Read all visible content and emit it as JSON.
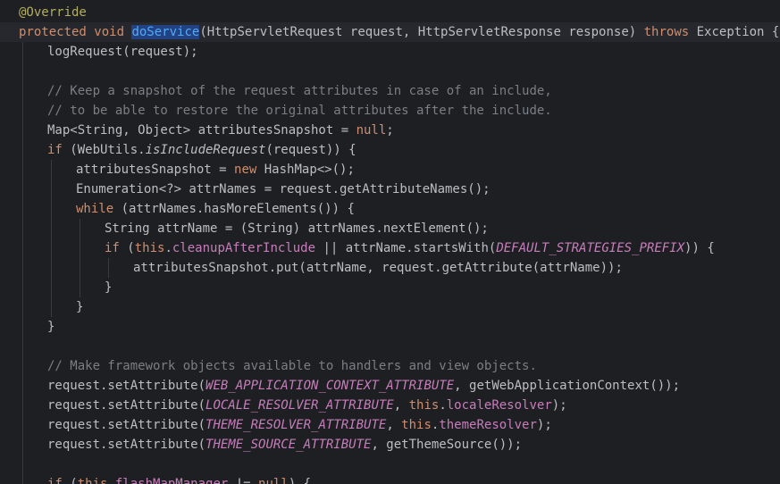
{
  "editor": {
    "colors": {
      "background": "#1e1f22",
      "current_line": "#26282e",
      "keyword": "#cf8e6d",
      "annotation": "#b3ae60",
      "method": "#56a8f5",
      "comment": "#7a7e85",
      "constant": "#c77dbb",
      "text": "#bcbec4",
      "selection": "#214283"
    },
    "lines": [
      {
        "indent": 0,
        "tokens": [
          {
            "t": "ann",
            "v": "@Override"
          }
        ]
      },
      {
        "indent": 0,
        "current": true,
        "tokens": [
          {
            "t": "kw",
            "v": "protected"
          },
          {
            "t": "plain",
            "v": " "
          },
          {
            "t": "kw",
            "v": "void"
          },
          {
            "t": "plain",
            "v": " "
          },
          {
            "t": "fnsel",
            "v": "doService"
          },
          {
            "t": "plain",
            "v": "(HttpServletRequest request, HttpServletResponse response) "
          },
          {
            "t": "kw",
            "v": "throws"
          },
          {
            "t": "plain",
            "v": " Exception {"
          }
        ]
      },
      {
        "indent": 1,
        "tokens": [
          {
            "t": "plain",
            "v": "logRequest(request);"
          }
        ]
      },
      {
        "indent": 1,
        "tokens": []
      },
      {
        "indent": 1,
        "tokens": [
          {
            "t": "cm",
            "v": "// Keep a snapshot of the request attributes in case of an include,"
          }
        ]
      },
      {
        "indent": 1,
        "tokens": [
          {
            "t": "cm",
            "v": "// to be able to restore the original attributes after the include."
          }
        ]
      },
      {
        "indent": 1,
        "tokens": [
          {
            "t": "plain",
            "v": "Map<String, Object> attributesSnapshot = "
          },
          {
            "t": "kw",
            "v": "null"
          },
          {
            "t": "plain",
            "v": ";"
          }
        ]
      },
      {
        "indent": 1,
        "tokens": [
          {
            "t": "kw",
            "v": "if"
          },
          {
            "t": "plain",
            "v": " (WebUtils."
          },
          {
            "t": "static",
            "v": "isIncludeRequest"
          },
          {
            "t": "plain",
            "v": "(request)) {"
          }
        ]
      },
      {
        "indent": 2,
        "tokens": [
          {
            "t": "plain",
            "v": "attributesSnapshot = "
          },
          {
            "t": "kw",
            "v": "new"
          },
          {
            "t": "plain",
            "v": " HashMap<>();"
          }
        ]
      },
      {
        "indent": 2,
        "tokens": [
          {
            "t": "plain",
            "v": "Enumeration<?> attrNames = request.getAttributeNames();"
          }
        ]
      },
      {
        "indent": 2,
        "tokens": [
          {
            "t": "kw",
            "v": "while"
          },
          {
            "t": "plain",
            "v": " (attrNames.hasMoreElements()) {"
          }
        ]
      },
      {
        "indent": 3,
        "tokens": [
          {
            "t": "plain",
            "v": "String attrName = (String) attrNames.nextElement();"
          }
        ]
      },
      {
        "indent": 3,
        "tokens": [
          {
            "t": "kw",
            "v": "if"
          },
          {
            "t": "plain",
            "v": " ("
          },
          {
            "t": "kw",
            "v": "this"
          },
          {
            "t": "plain",
            "v": "."
          },
          {
            "t": "field",
            "v": "cleanupAfterInclude"
          },
          {
            "t": "plain",
            "v": " || attrName.startsWith("
          },
          {
            "t": "const",
            "v": "DEFAULT_STRATEGIES_PREFIX"
          },
          {
            "t": "plain",
            "v": ")) {"
          }
        ]
      },
      {
        "indent": 4,
        "tokens": [
          {
            "t": "plain",
            "v": "attributesSnapshot.put(attrName, request.getAttribute(attrName));"
          }
        ]
      },
      {
        "indent": 3,
        "tokens": [
          {
            "t": "plain",
            "v": "}"
          }
        ]
      },
      {
        "indent": 2,
        "tokens": [
          {
            "t": "plain",
            "v": "}"
          }
        ]
      },
      {
        "indent": 1,
        "tokens": [
          {
            "t": "plain",
            "v": "}"
          }
        ]
      },
      {
        "indent": 1,
        "tokens": []
      },
      {
        "indent": 1,
        "tokens": [
          {
            "t": "cm",
            "v": "// Make framework objects available to handlers and view objects."
          }
        ]
      },
      {
        "indent": 1,
        "tokens": [
          {
            "t": "plain",
            "v": "request.setAttribute("
          },
          {
            "t": "const",
            "v": "WEB_APPLICATION_CONTEXT_ATTRIBUTE"
          },
          {
            "t": "plain",
            "v": ", getWebApplicationContext());"
          }
        ]
      },
      {
        "indent": 1,
        "tokens": [
          {
            "t": "plain",
            "v": "request.setAttribute("
          },
          {
            "t": "const",
            "v": "LOCALE_RESOLVER_ATTRIBUTE"
          },
          {
            "t": "plain",
            "v": ", "
          },
          {
            "t": "kw",
            "v": "this"
          },
          {
            "t": "plain",
            "v": "."
          },
          {
            "t": "field",
            "v": "localeResolver"
          },
          {
            "t": "plain",
            "v": ");"
          }
        ]
      },
      {
        "indent": 1,
        "tokens": [
          {
            "t": "plain",
            "v": "request.setAttribute("
          },
          {
            "t": "const",
            "v": "THEME_RESOLVER_ATTRIBUTE"
          },
          {
            "t": "plain",
            "v": ", "
          },
          {
            "t": "kw",
            "v": "this"
          },
          {
            "t": "plain",
            "v": "."
          },
          {
            "t": "field",
            "v": "themeResolver"
          },
          {
            "t": "plain",
            "v": ");"
          }
        ]
      },
      {
        "indent": 1,
        "tokens": [
          {
            "t": "plain",
            "v": "request.setAttribute("
          },
          {
            "t": "const",
            "v": "THEME_SOURCE_ATTRIBUTE"
          },
          {
            "t": "plain",
            "v": ", getThemeSource());"
          }
        ]
      },
      {
        "indent": 1,
        "tokens": []
      },
      {
        "indent": 1,
        "tokens": [
          {
            "t": "kw",
            "v": "if"
          },
          {
            "t": "plain",
            "v": " ("
          },
          {
            "t": "kw",
            "v": "this"
          },
          {
            "t": "plain",
            "v": "."
          },
          {
            "t": "field",
            "v": "flashMapManager"
          },
          {
            "t": "plain",
            "v": " != "
          },
          {
            "t": "kw",
            "v": "null"
          },
          {
            "t": "plain",
            "v": ") {"
          }
        ]
      }
    ]
  }
}
